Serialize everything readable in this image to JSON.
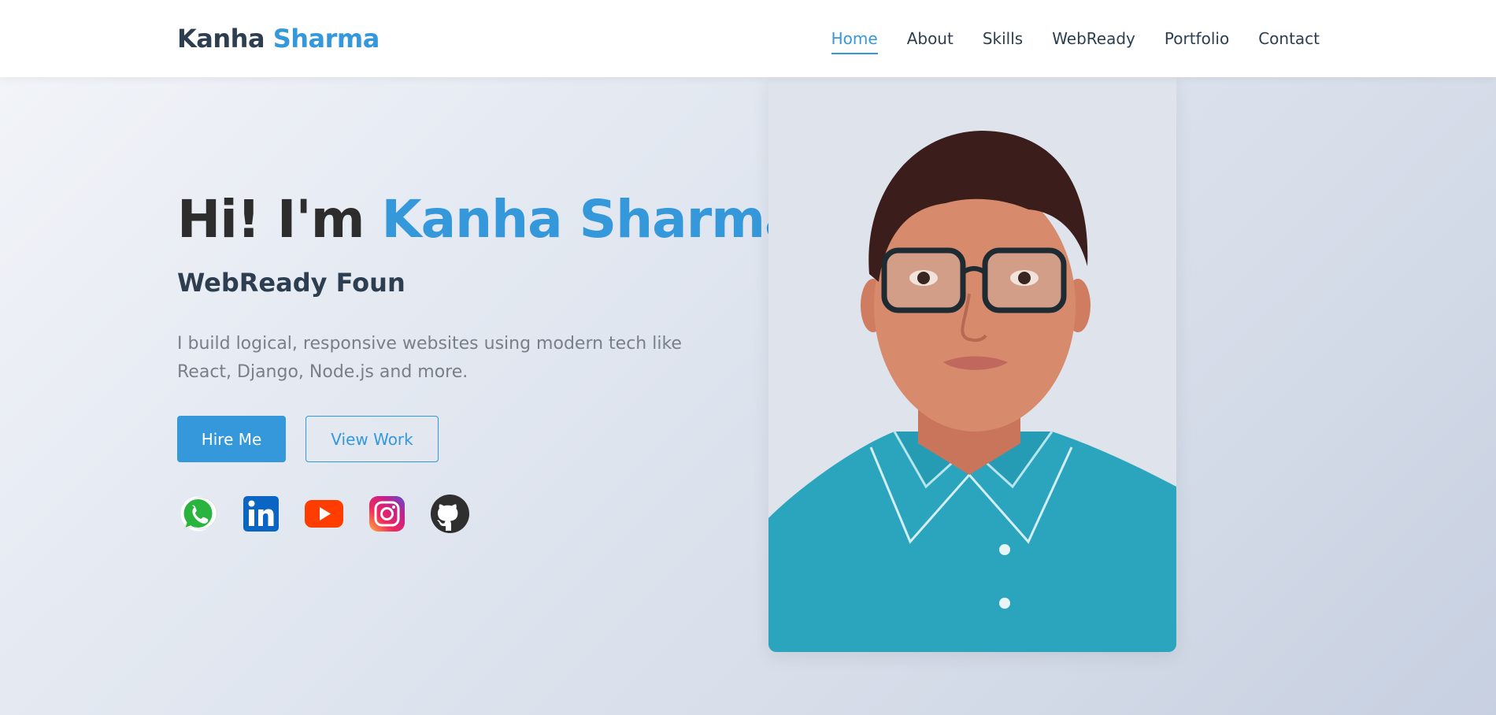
{
  "nav": {
    "brand_first": "Kanha",
    "brand_last": "Sharma",
    "links": [
      "Home",
      "About",
      "Skills",
      "WebReady",
      "Portfolio",
      "Contact"
    ],
    "active": "Home"
  },
  "hero": {
    "greeting": "Hi! I'm",
    "name": "Kanha Sharma",
    "subtitle": "WebReady Foun",
    "description": "I build logical, responsive websites using modern tech like React, Django, Node.js and more.",
    "hire_label": "Hire Me",
    "view_label": "View Work"
  },
  "socials": [
    "whatsapp-icon",
    "linkedin-icon",
    "youtube-icon",
    "instagram-icon",
    "github-icon"
  ],
  "colors": {
    "accent": "#3498db",
    "dark": "#2c3e50",
    "text_muted": "#7a7f87"
  }
}
